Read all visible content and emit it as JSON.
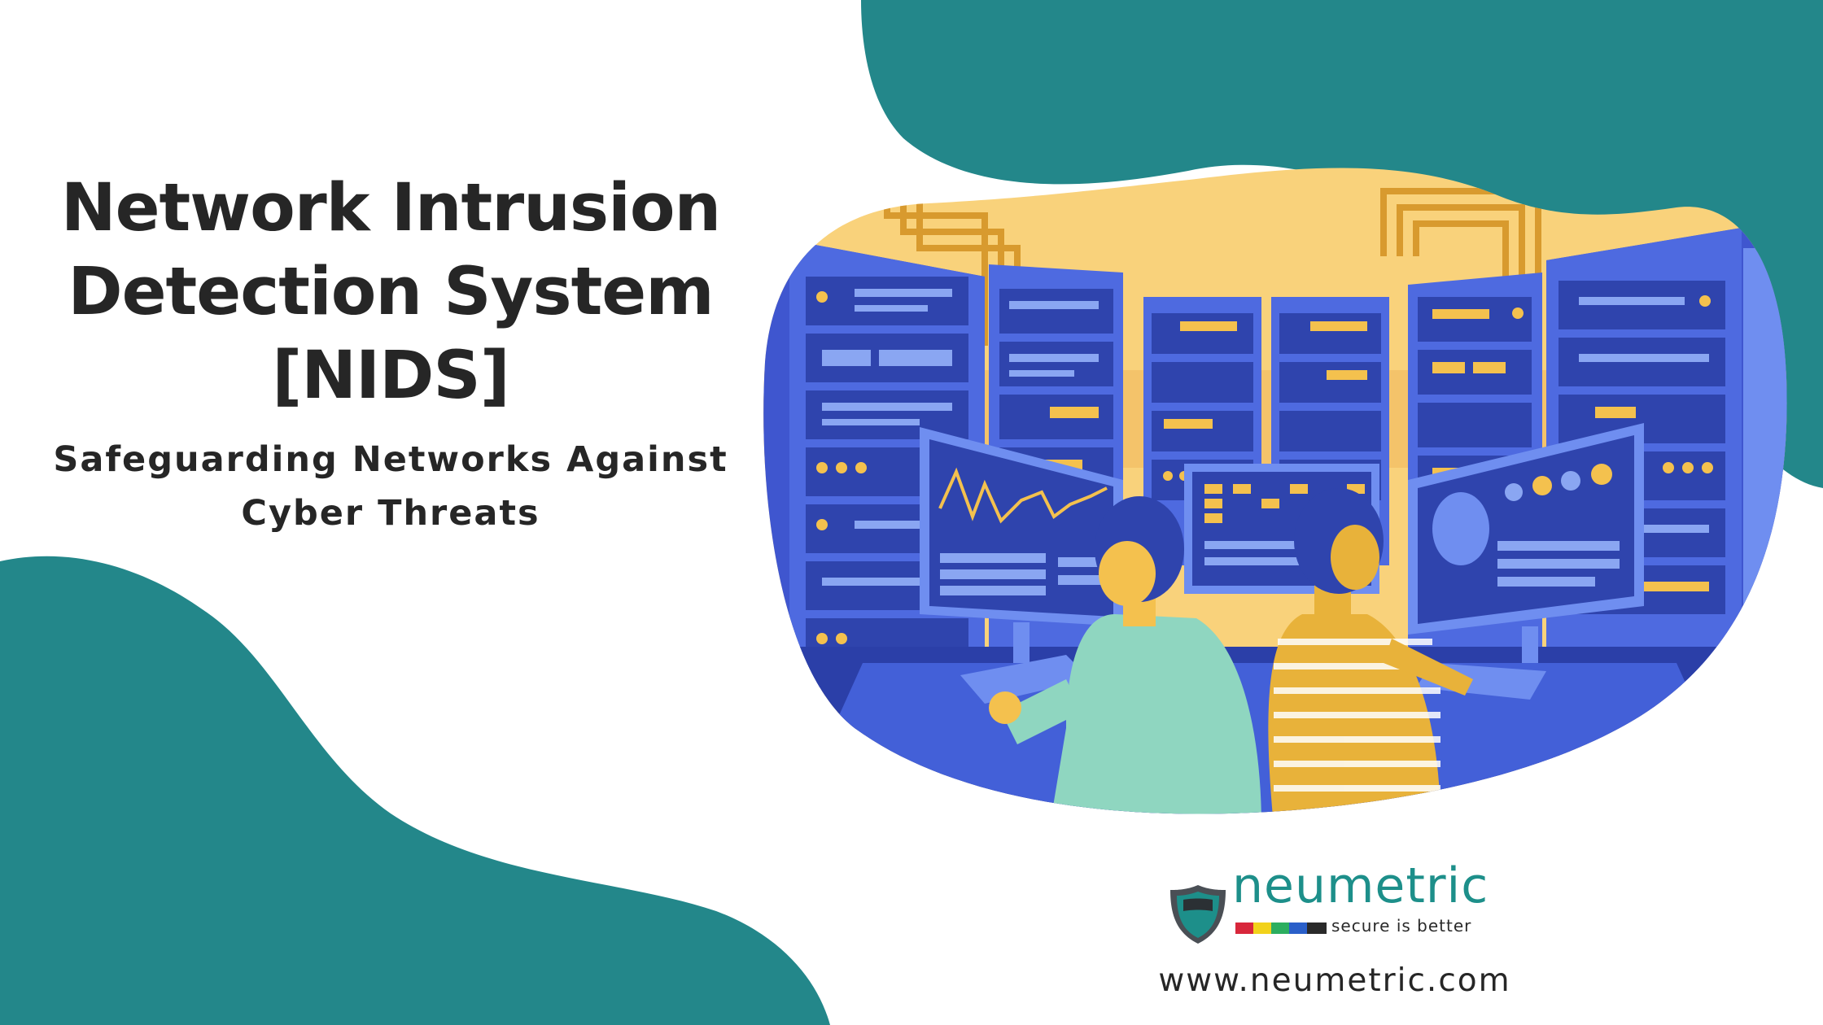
{
  "heading": {
    "line1": "Network Intrusion",
    "line2": "Detection System",
    "line3": "[NIDS]"
  },
  "subheading": {
    "line1": "Safeguarding Networks Against",
    "line2": "Cyber Threats"
  },
  "brand": {
    "name": "neumetric",
    "tagline": "secure is better",
    "url": "www.neumetric.com",
    "teal": "#23878a"
  },
  "illustration": {
    "subject": "security analysts monitoring server racks and network screens",
    "icons": [
      "server-rack-icon",
      "monitor-icon",
      "keyboard-icon",
      "person-icon"
    ]
  },
  "colors": {
    "background": "#ffffff",
    "accent": "#23878a",
    "text": "#262626",
    "rack_blue": "#3f56cf",
    "screen_blue": "#5c7fe0",
    "yellow": "#f9d27b",
    "amber": "#e8b23a"
  }
}
